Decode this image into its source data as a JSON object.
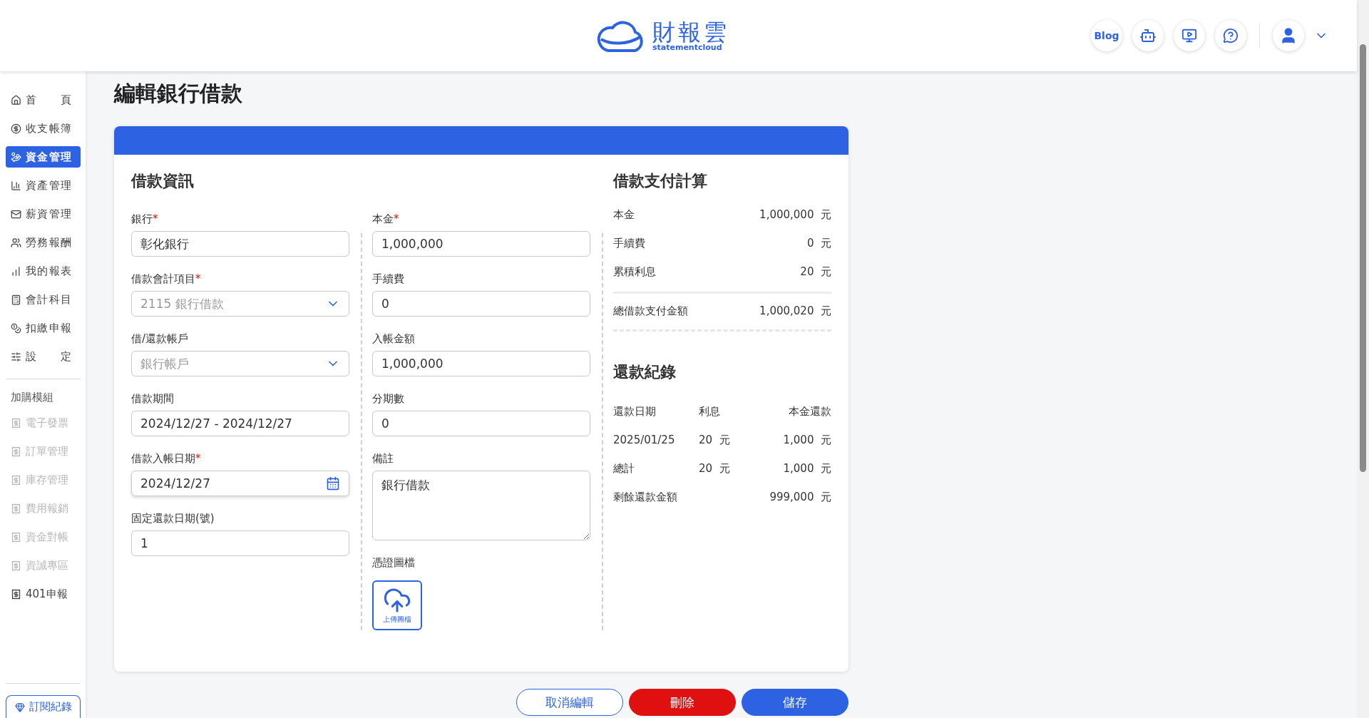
{
  "header": {
    "logo": {
      "name": "財報雲",
      "sub": "statementcloud"
    },
    "blog": "Blog"
  },
  "sidebar": {
    "items": [
      {
        "label": "首 頁",
        "selected": false
      },
      {
        "label": "收支帳簿",
        "selected": false
      },
      {
        "label": "資金管理",
        "selected": true
      },
      {
        "label": "資產管理",
        "selected": false
      },
      {
        "label": "薪資管理",
        "selected": false
      },
      {
        "label": "勞務報酬",
        "selected": false
      },
      {
        "label": "我的報表",
        "selected": false
      },
      {
        "label": "會計科目",
        "selected": false
      },
      {
        "label": "扣繳申報",
        "selected": false
      },
      {
        "label": "設 定",
        "selected": false
      }
    ],
    "section_title": "加購模組",
    "addons": [
      {
        "label": "電子發票",
        "disabled": true
      },
      {
        "label": "訂單管理",
        "disabled": true
      },
      {
        "label": "庫存管理",
        "disabled": true
      },
      {
        "label": "費用報銷",
        "disabled": true
      },
      {
        "label": "資金對帳",
        "disabled": true
      },
      {
        "label": "資誠專區",
        "disabled": true
      },
      {
        "label": "401申報",
        "disabled": false
      }
    ],
    "subscription_button": "訂閱紀錄"
  },
  "page_title": "編輯銀行借款",
  "form": {
    "title": "借款資訊",
    "required_mark": "*",
    "left_fields": [
      {
        "label": "銀行",
        "required": true,
        "kind": "text",
        "value": "彰化銀行"
      },
      {
        "label": "借款會計項目",
        "required": true,
        "kind": "select",
        "placeholder": "2115 銀行借款"
      },
      {
        "label": "借/還款帳戶",
        "required": false,
        "kind": "select",
        "placeholder": "銀行帳戶"
      },
      {
        "label": "借款期間",
        "required": false,
        "kind": "text",
        "value": "2024/12/27 - 2024/12/27"
      },
      {
        "label": "借款入帳日期",
        "required": true,
        "kind": "date",
        "value": "2024/12/27"
      },
      {
        "label": "固定還款日期(號)",
        "required": false,
        "kind": "text",
        "value": "1"
      }
    ],
    "right_fields": [
      {
        "label": "本金",
        "required": true,
        "kind": "text",
        "value": "1,000,000"
      },
      {
        "label": "手續費",
        "required": false,
        "kind": "text",
        "value": "0"
      },
      {
        "label": "入帳金額",
        "required": false,
        "kind": "text",
        "value": "1,000,000"
      },
      {
        "label": "分期數",
        "required": false,
        "kind": "text",
        "value": "0"
      },
      {
        "label": "備註",
        "required": false,
        "kind": "textarea",
        "value": "銀行借款"
      }
    ],
    "upload": {
      "label": "憑證圖檔",
      "button": "上傳圖檔"
    }
  },
  "summary": {
    "title": "借款支付計算",
    "rows": [
      {
        "label": "本金",
        "value": "1,000,000",
        "unit": "元"
      },
      {
        "label": "手續費",
        "value": "0",
        "unit": "元"
      },
      {
        "label": "累積利息",
        "value": "20",
        "unit": "元"
      }
    ],
    "total": {
      "label": "總借款支付金額",
      "value": "1,000,020",
      "unit": "元"
    }
  },
  "repayments": {
    "title": "還款紀錄",
    "columns": [
      "還款日期",
      "利息",
      "本金還款"
    ],
    "rows": [
      {
        "date": "2025/01/25",
        "interest": "20",
        "interest_unit": "元",
        "principal": "1,000",
        "principal_unit": "元"
      },
      {
        "date": "總計",
        "interest": "20",
        "interest_unit": "元",
        "principal": "1,000",
        "principal_unit": "元"
      }
    ],
    "remaining": {
      "label": "剩餘還款金額",
      "value": "999,000",
      "unit": "元"
    }
  },
  "buttons": [
    {
      "label": "取消編輯",
      "kind": "outline"
    },
    {
      "label": "刪除",
      "kind": "danger"
    },
    {
      "label": "儲存",
      "kind": "primary"
    }
  ]
}
